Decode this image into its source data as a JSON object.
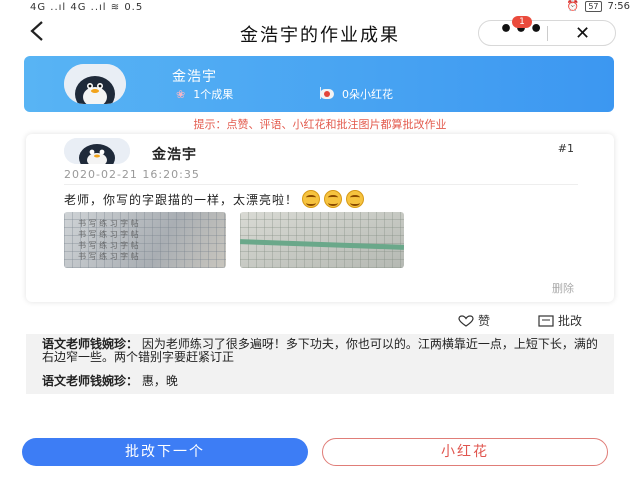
{
  "status_bar": {
    "left": "4G ..ıl 4G ..ıl ≋ 0.5",
    "battery": "57",
    "time": "7:56",
    "notif_count": "1"
  },
  "nav": {
    "title": "金浩宇的作业成果",
    "more": "•••",
    "close": "✕"
  },
  "header": {
    "student": "金浩宇",
    "results": "1个成果",
    "flowers": "0朵小红花",
    "tip": "提示：点赞、评语、小红花和批注图片都算批改作业"
  },
  "homework": {
    "student": "金浩宇",
    "number": "#1",
    "time": "2020-02-21 16:20:35",
    "text": "老师，你写的字跟描的一样，太漂亮啦！",
    "delete": "删除"
  },
  "actions": {
    "like": "赞",
    "review": "批改"
  },
  "comments": [
    {
      "author": "语文老师钱婉珍：",
      "text": "因为老师练习了很多遍呀！多下功夫，你也可以的。江两横靠近一点，上短下长，满的右边窄一些。两个错别字要赶紧订正"
    },
    {
      "author": "语文老师钱婉珍：",
      "text": "惠，晚"
    }
  ],
  "buttons": {
    "next": "批改下一个",
    "flower": "小红花"
  },
  "colors": {
    "header_blue": "#3c97f1",
    "primary_button": "#3d7df5",
    "tip_red": "#e35b4e"
  }
}
